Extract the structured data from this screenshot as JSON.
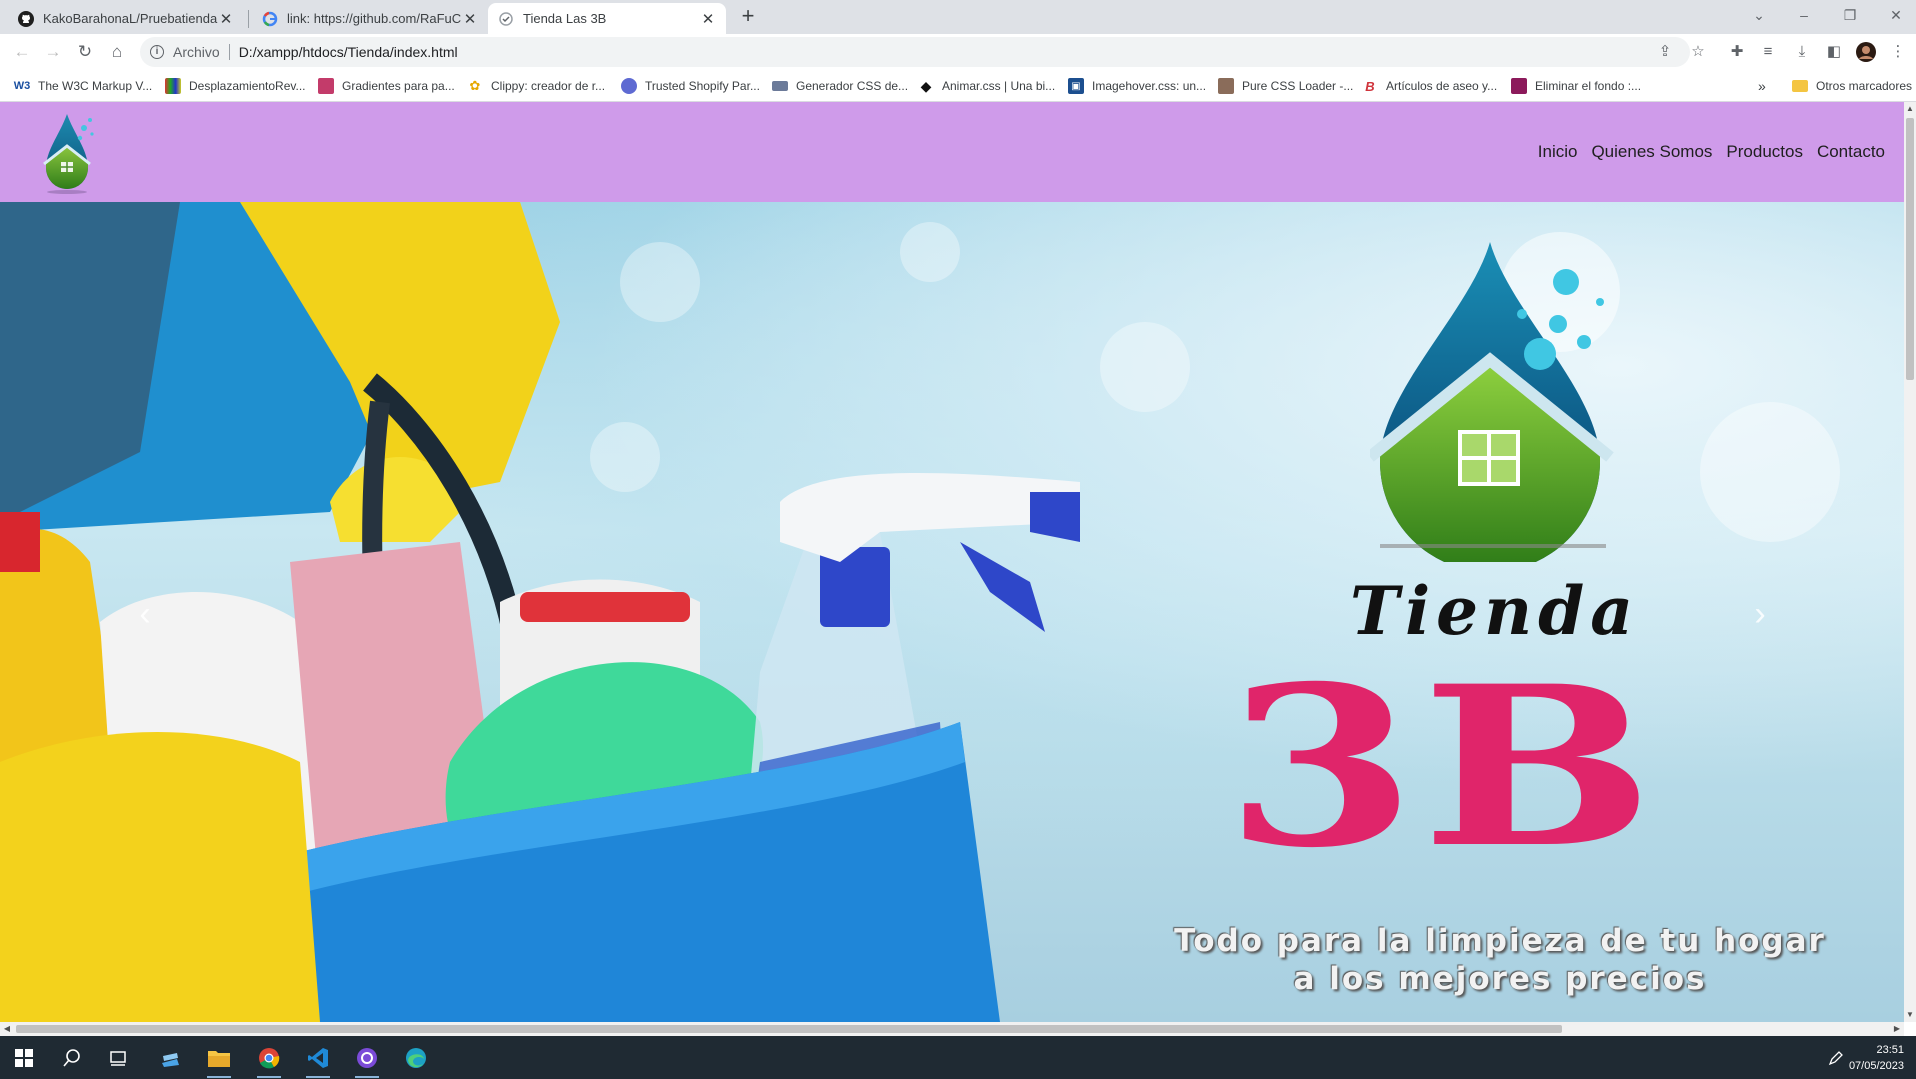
{
  "browser": {
    "tabs": [
      {
        "title": "KakoBarahonaL/Pruebatienda: Re",
        "icon": "github-icon",
        "active": false
      },
      {
        "title": "link: https://github.com/RaFuCho",
        "icon": "google-icon",
        "active": false
      },
      {
        "title": "Tienda Las 3B",
        "icon": "page-loading-icon",
        "active": true
      }
    ],
    "omnibox": {
      "scheme_label": "Archivo",
      "url": "D:/xampp/htdocs/Tienda/index.html"
    },
    "bookmarks": [
      {
        "label": "The W3C Markup V...",
        "icon": "w3c-icon"
      },
      {
        "label": "DesplazamientoRev...",
        "icon": "bookmark-icon"
      },
      {
        "label": "Gradientes para pa...",
        "icon": "bookmark-icon"
      },
      {
        "label": "Clippy: creador de r...",
        "icon": "clippy-icon"
      },
      {
        "label": "Trusted Shopify Par...",
        "icon": "shopify-icon"
      },
      {
        "label": "Generador CSS de...",
        "icon": "bookmark-icon"
      },
      {
        "label": "Animar.css | Una bi...",
        "icon": "animate-icon"
      },
      {
        "label": "Imagehover.css: un...",
        "icon": "image-icon"
      },
      {
        "label": "Pure CSS Loader -...",
        "icon": "bookmark-icon"
      },
      {
        "label": "Artículos de aseo y...",
        "icon": "bookmark-icon"
      },
      {
        "label": "Eliminar el fondo :...",
        "icon": "bookmark-icon"
      }
    ],
    "other_bookmarks": "Otros marcadores"
  },
  "site": {
    "nav": [
      "Inicio",
      "Quienes Somos",
      "Productos",
      "Contacto"
    ],
    "hero": {
      "brand_word": "Tienda",
      "brand_mark": "3B",
      "tagline_line1": "Todo para la limpieza de tu hogar",
      "tagline_line2": "a los mejores precios"
    },
    "colors": {
      "navbar": "#cf9bea",
      "brand_pink": "#e0256a"
    }
  },
  "taskbar": {
    "time": "23:51",
    "date": "07/05/2023",
    "apps": [
      "windows-start-icon",
      "search-icon",
      "task-view-icon",
      "stack-icon",
      "file-explorer-icon",
      "chrome-icon",
      "vscode-icon",
      "github-desktop-icon",
      "edge-icon"
    ]
  }
}
